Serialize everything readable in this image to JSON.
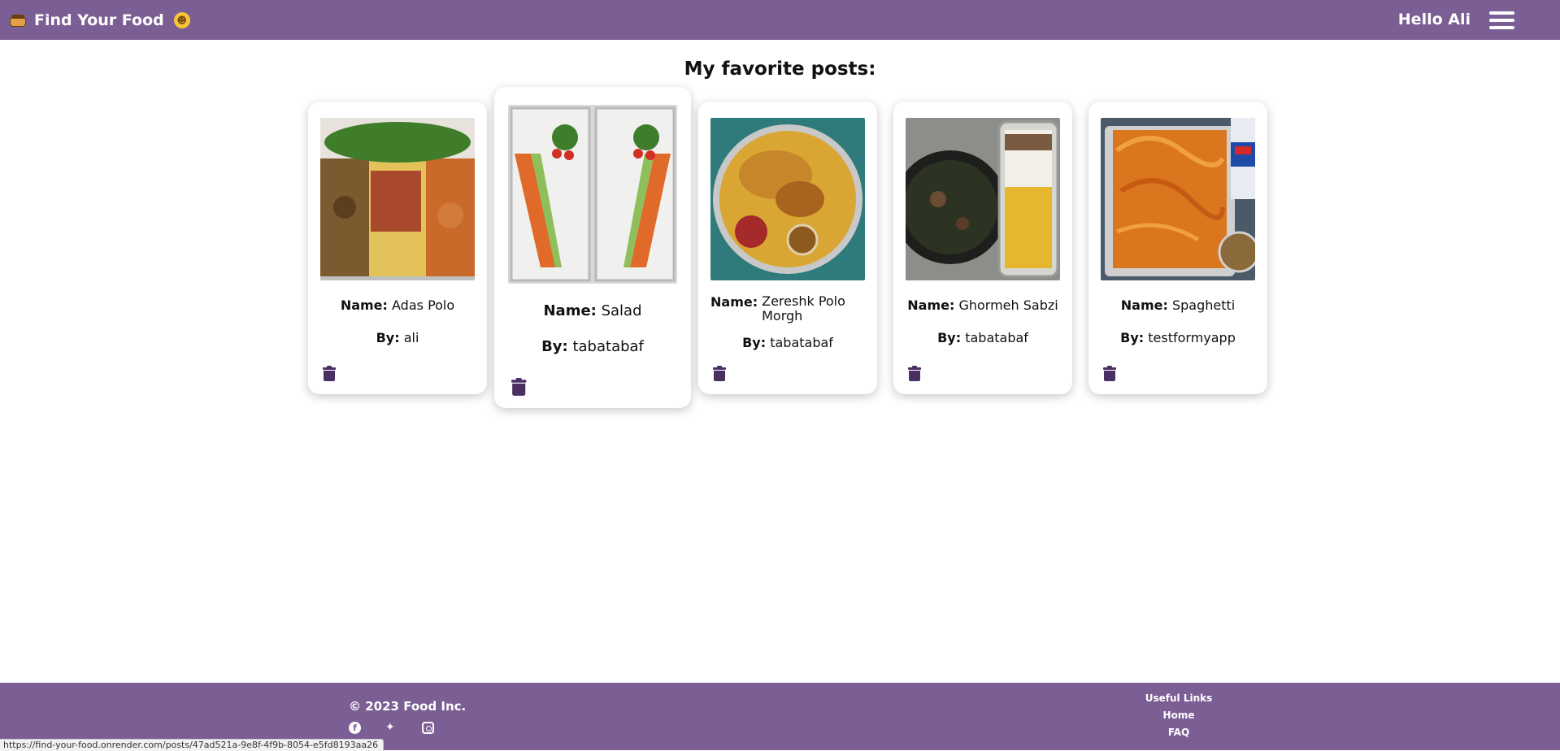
{
  "navbar": {
    "brand_title": "Find Your Food",
    "brand_icon": "cooking-pot-icon",
    "emoji_icon": "yum-face-icon",
    "greeting": "Hello Ali",
    "menu_icon": "hamburger-menu-icon",
    "color": "#7b5e93"
  },
  "main": {
    "heading": "My favorite posts:",
    "name_label": "Name:",
    "by_label": "By:",
    "delete_icon": "trash-icon",
    "posts": [
      {
        "name": "Adas Polo",
        "author": "ali"
      },
      {
        "name": "Salad",
        "author": "tabatabaf"
      },
      {
        "name": "Zereshk Polo Morgh",
        "author": "tabatabaf"
      },
      {
        "name": "Ghormeh Sabzi",
        "author": "tabatabaf"
      },
      {
        "name": "Spaghetti",
        "author": "testformyapp"
      }
    ]
  },
  "footer": {
    "copyright": "© 2023 Food Inc.",
    "socials": [
      "facebook-icon",
      "twitter-icon",
      "instagram-icon"
    ],
    "links_title": "Useful Links",
    "links": [
      "Home",
      "FAQ"
    ]
  },
  "status_bar": {
    "url": "https://find-your-food.onrender.com/posts/47ad521a-9e8f-4f9b-8054-e5fd8193aa26"
  }
}
